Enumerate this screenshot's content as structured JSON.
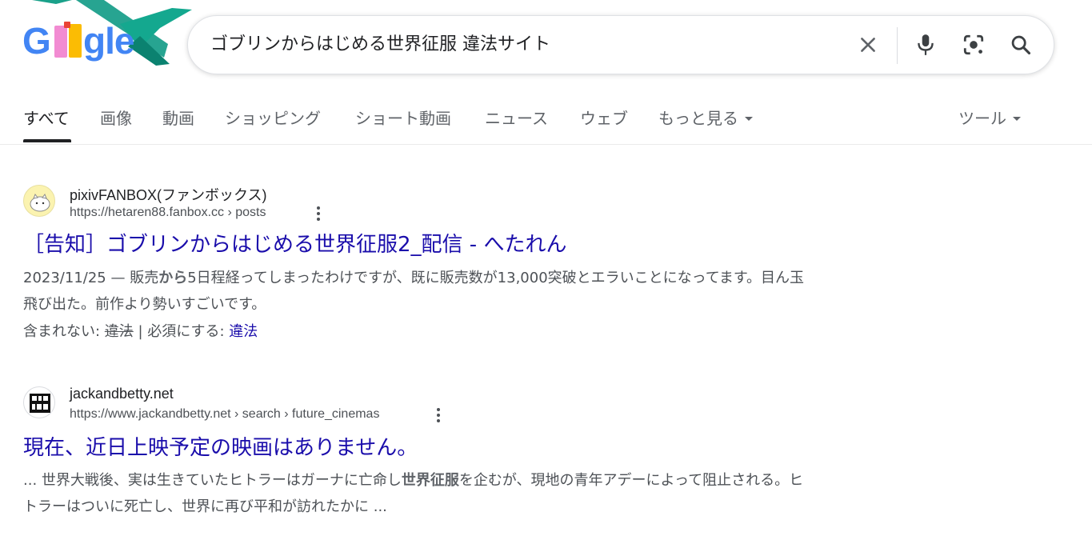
{
  "search": {
    "query": "ゴブリンからはじめる世界征服 違法サイト",
    "icons": [
      "close-icon",
      "microphone-icon",
      "lens-icon",
      "search-icon"
    ]
  },
  "logo": {
    "letters_left": "G",
    "letters_right": "gle"
  },
  "tabs": [
    {
      "label": "すべて",
      "active": true
    },
    {
      "label": "画像"
    },
    {
      "label": "動画"
    },
    {
      "label": "ショッピング"
    },
    {
      "label": "ショート動画"
    },
    {
      "label": "ニュース"
    },
    {
      "label": "ウェブ"
    },
    {
      "label": "もっと見る"
    }
  ],
  "tools_label": "ツール",
  "results": [
    {
      "site_name": "pixivFANBOX(ファンボックス)",
      "url": "https://hetaren88.fanbox.cc › posts",
      "title": "［告知］ゴブリンからはじめる世界征服2_配信 - へたれん",
      "date": "2023/11/25",
      "dash": " — ",
      "snippet_a": "販売",
      "snippet_b": "から",
      "snippet_c": "5日程経ってしまったわけですが、既に販売数が13,000突破とエラいことになってます。目ん玉飛び出た。前作より勢いすごいです。",
      "missing_label": "含まれない: ",
      "missing_term": "違法",
      "missing_sep": " | 必須にする: ",
      "require_term": "違法"
    },
    {
      "site_name": "jackandbetty.net",
      "url": "https://www.jackandbetty.net › search › future_cinemas",
      "title": "現在、近日上映予定の映画はありません。",
      "snippet_a": "... 世界大戦後、実は生きていたヒトラーはガーナに亡命し",
      "snippet_b": "世界征服",
      "snippet_c": "を企むが、現地の青年アデーによって阻止される。ヒトラーはついに死亡し、世界に再び平和が訪れたかに ..."
    }
  ],
  "colors": {
    "link": "#1a0dab",
    "snippet": "#4d5156",
    "tab_inactive": "#5f6368",
    "border": "#dfe1e5"
  }
}
